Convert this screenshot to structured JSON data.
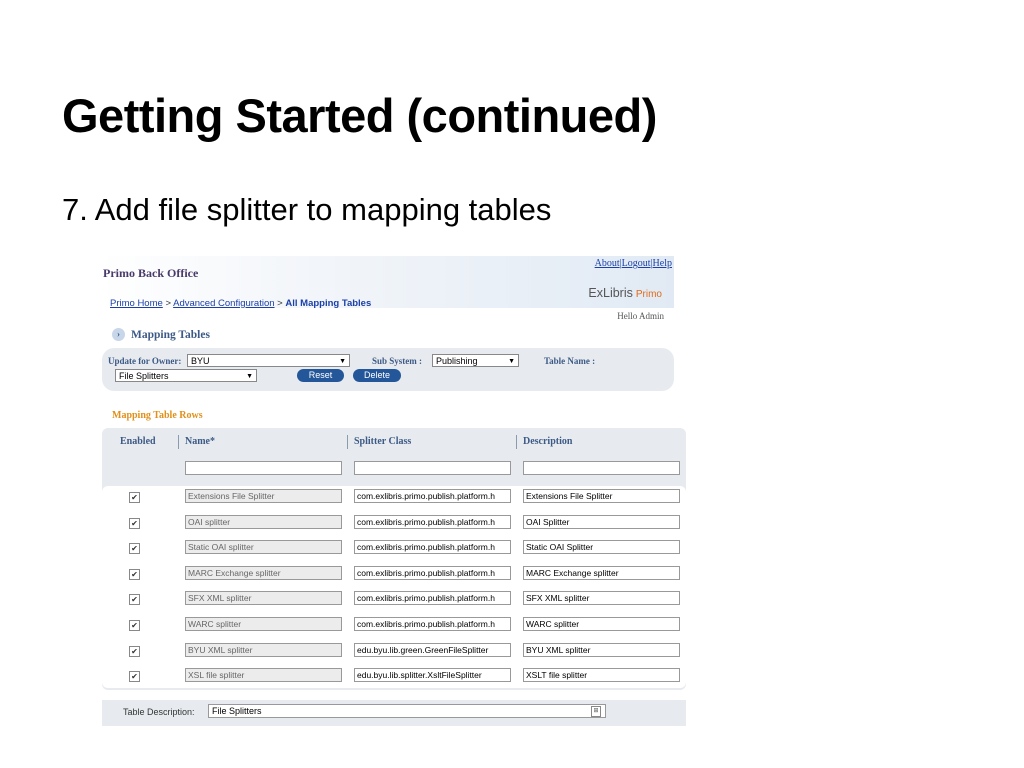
{
  "slide": {
    "title": "Getting Started (continued)",
    "subtitle": "7. Add file splitter to mapping tables"
  },
  "app": {
    "title": "Primo Back Office",
    "top_links": [
      "About",
      "Logout",
      "Help"
    ],
    "breadcrumb": {
      "home": "Primo Home",
      "advanced": "Advanced Configuration",
      "current": "All Mapping Tables",
      "separator": ">"
    },
    "logo": {
      "brand": "ExLibris",
      "product": "Primo"
    },
    "greeting": "Hello Admin"
  },
  "section": {
    "title": "Mapping Tables",
    "icon": "chevron-right-icon"
  },
  "filters": {
    "owner_label": "Update for Owner:",
    "owner_value": "BYU",
    "subsystem_label": "Sub System :",
    "subsystem_value": "Publishing",
    "tablename_label": "Table Name :",
    "tablename_value": "File Splitters",
    "reset_label": "Reset",
    "delete_label": "Delete"
  },
  "rows_title": "Mapping Table Rows",
  "columns": [
    "Enabled",
    "Name*",
    "Splitter Class",
    "Description"
  ],
  "rows": [
    {
      "name": "Extensions File Splitter",
      "class": "com.exlibris.primo.publish.platform.h",
      "desc": "Extensions File Splitter"
    },
    {
      "name": "OAI splitter",
      "class": "com.exlibris.primo.publish.platform.h",
      "desc": "OAI Splitter"
    },
    {
      "name": "Static OAI splitter",
      "class": "com.exlibris.primo.publish.platform.h",
      "desc": "Static OAI Splitter"
    },
    {
      "name": "MARC Exchange splitter",
      "class": "com.exlibris.primo.publish.platform.h",
      "desc": "MARC Exchange splitter"
    },
    {
      "name": "SFX XML splitter",
      "class": "com.exlibris.primo.publish.platform.h",
      "desc": "SFX XML splitter"
    },
    {
      "name": "WARC splitter",
      "class": "com.exlibris.primo.publish.platform.h",
      "desc": "WARC splitter"
    },
    {
      "name": "BYU XML splitter",
      "class": "edu.byu.lib.green.GreenFileSplitter",
      "desc": "BYU XML splitter"
    },
    {
      "name": "XSL file splitter",
      "class": "edu.byu.lib.splitter.XsltFileSplitter",
      "desc": "XSLT file splitter"
    }
  ],
  "checkmark": "✔",
  "footer": {
    "label": "Table Description:",
    "value": "File Splitters"
  }
}
